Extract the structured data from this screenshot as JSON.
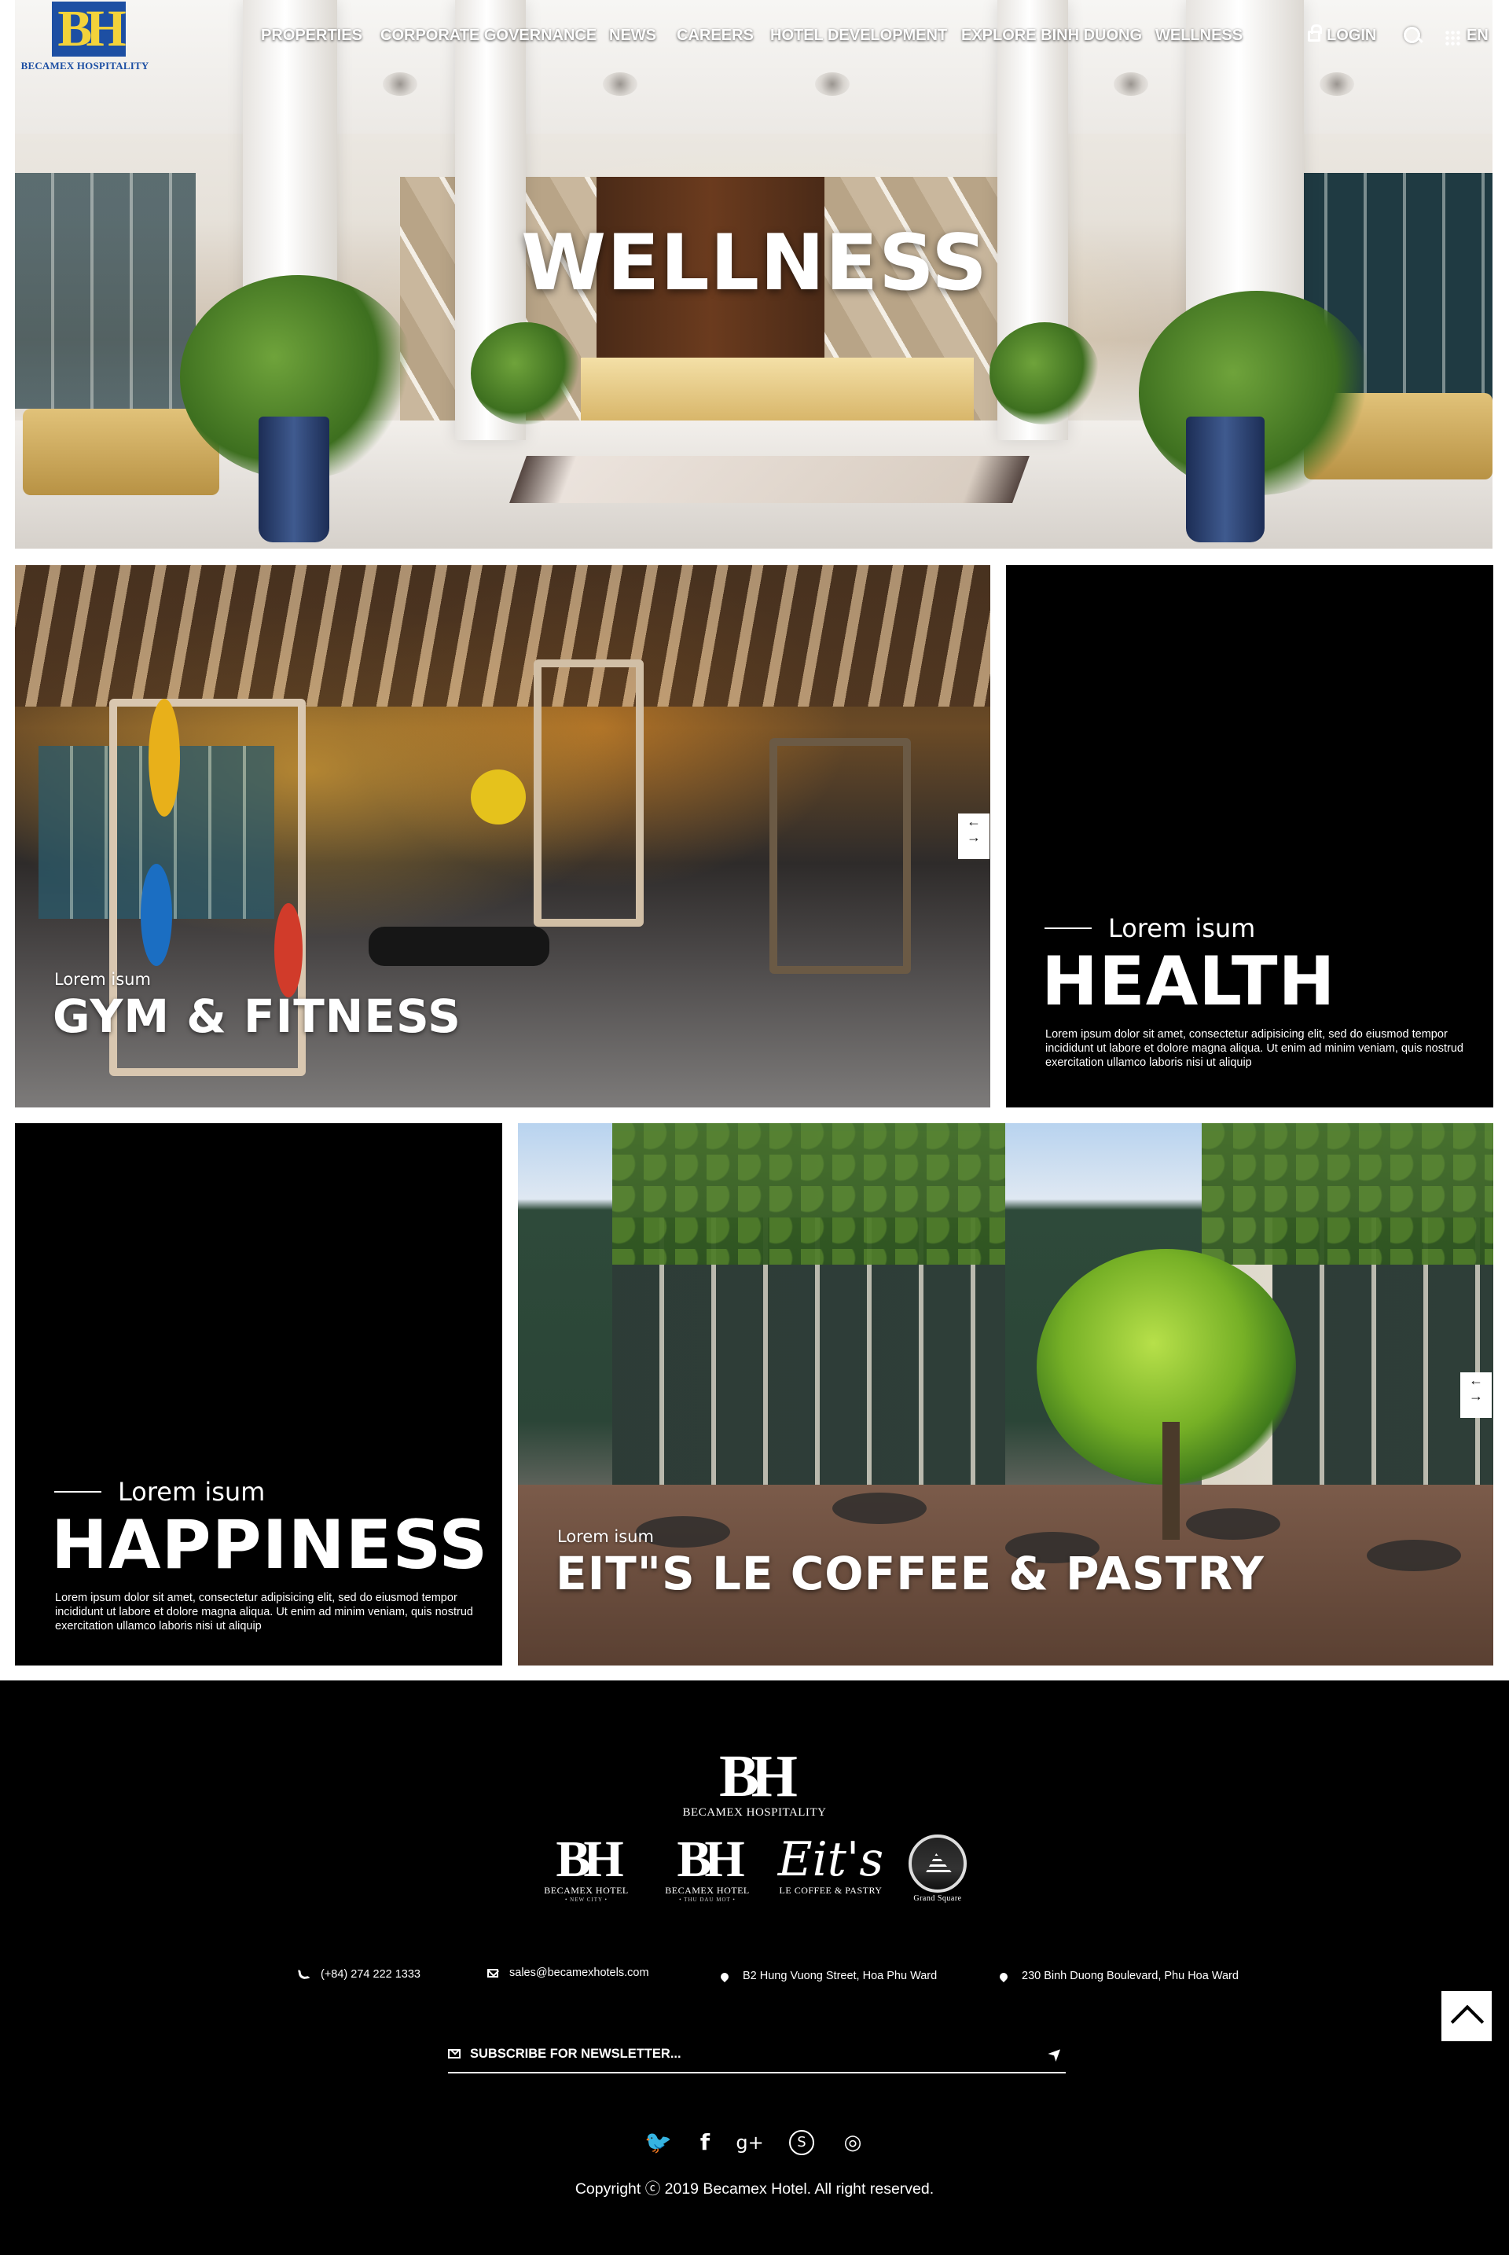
{
  "brand": {
    "logo_mark": "BH",
    "logo_text": "BECAMEX HOSPITALITY"
  },
  "nav": {
    "items": [
      "PROPERTIES",
      "CORPORATE GOVERNANCE",
      "NEWS",
      "CAREERS",
      "HOTEL DEVELOPMENT",
      "EXPLORE BINH DUONG",
      "WELLNESS"
    ],
    "login": "LOGIN",
    "language": "EN"
  },
  "hero": {
    "title": "WELLNESS"
  },
  "tiles": {
    "gym": {
      "kicker": "Lorem isum",
      "title": "GYM & FITNESS"
    },
    "health": {
      "kicker": "Lorem isum",
      "title": "HEALTH",
      "description": "Lorem ipsum dolor sit amet, consectetur adipisicing elit, sed do eiusmod tempor incididunt ut labore et dolore magna aliqua. Ut enim ad minim veniam, quis nostrud exercitation ullamco laboris nisi ut aliquip"
    },
    "happiness": {
      "kicker": "Lorem isum",
      "title": "HAPPINESS",
      "description": "Lorem ipsum dolor sit amet, consectetur adipisicing elit, sed do eiusmod tempor incididunt ut labore et dolore magna aliqua. Ut enim ad minim veniam, quis nostrud exercitation ullamco laboris nisi ut aliquip"
    },
    "coffee": {
      "kicker": "Lorem isum",
      "title": "EIT\"S LE COFFEE & PASTRY"
    },
    "arrow_prev": "←",
    "arrow_next": "→"
  },
  "footer": {
    "logo_mark": "BH",
    "logo_text": "BECAMEX HOSPITALITY",
    "brands": [
      {
        "mark": "BH",
        "name": "BECAMEX HOTEL",
        "tag": "• NEW CITY •"
      },
      {
        "mark": "BH",
        "name": "BECAMEX HOTEL",
        "tag": "• THU DAU MOT •"
      },
      {
        "mark": "Eit's",
        "name": "LE COFFEE & PASTRY"
      },
      {
        "name": "Grand Square"
      }
    ],
    "contacts": {
      "phone": "(+84) 274 222 1333",
      "email": "sales@becamexhotels.com",
      "address_1": "B2 Hung Vuong Street, Hoa Phu Ward",
      "address_2": "230 Binh Duong Boulevard, Phu Hoa Ward"
    },
    "newsletter_placeholder": "SUBSCRIBE FOR NEWSLETTER...",
    "social": [
      "twitter-icon",
      "facebook-icon",
      "google-plus-icon",
      "skype-icon",
      "instagram-icon"
    ],
    "social_glyphs": {
      "twitter": "🐦",
      "facebook": "f",
      "google_plus": "g+",
      "skype": "S",
      "instagram": "◎"
    },
    "copyright": "Copyright ⓒ 2019 Becamex Hotel. All right reserved."
  },
  "colors": {
    "brand_blue": "#1d4fa3",
    "brand_yellow": "#f3d23a",
    "footer_bg": "#000000"
  }
}
